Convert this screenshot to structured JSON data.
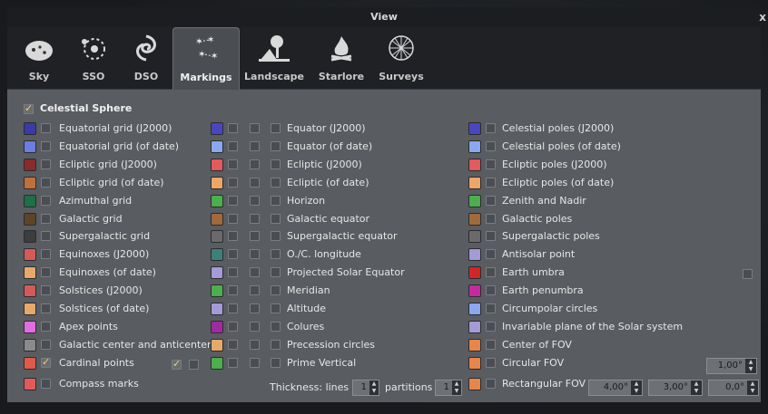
{
  "window": {
    "title": "View",
    "close_label": "x"
  },
  "tabs": [
    {
      "label": "Sky",
      "icon": "sky-icon"
    },
    {
      "label": "SSO",
      "icon": "sso-icon"
    },
    {
      "label": "DSO",
      "icon": "dso-icon"
    },
    {
      "label": "Markings",
      "icon": "markings-icon",
      "active": true
    },
    {
      "label": "Landscape",
      "icon": "landscape-icon"
    },
    {
      "label": "Starlore",
      "icon": "starlore-icon"
    },
    {
      "label": "Surveys",
      "icon": "surveys-icon"
    }
  ],
  "section": {
    "title": "Celestial Sphere",
    "checked": true
  },
  "col1": [
    {
      "label": "Equatorial grid (J2000)",
      "color": "#3b3aa6"
    },
    {
      "label": "Equatorial grid (of date)",
      "color": "#6a7fe0"
    },
    {
      "label": "Ecliptic grid (J2000)",
      "color": "#8a2b2b"
    },
    {
      "label": "Ecliptic grid (of date)",
      "color": "#c0703a"
    },
    {
      "label": "Azimuthal grid",
      "color": "#1f6e45"
    },
    {
      "label": "Galactic grid",
      "color": "#5c4428"
    },
    {
      "label": "Supergalactic grid",
      "color": "#3d3d3d"
    },
    {
      "label": "Equinoxes (J2000)",
      "color": "#d45a5a"
    },
    {
      "label": "Equinoxes (of date)",
      "color": "#e7a96a"
    },
    {
      "label": "Solstices (J2000)",
      "color": "#d45a5a"
    },
    {
      "label": "Solstices (of date)",
      "color": "#e7a96a"
    },
    {
      "label": "Apex points",
      "color": "#e06ee0"
    },
    {
      "label": "Galactic center and anticenter",
      "color": "#8a8a8a"
    },
    {
      "label": "Cardinal points",
      "color": "#e05a4a",
      "checked": true
    },
    {
      "label": "Compass marks",
      "color": "#e05a5a"
    }
  ],
  "col2": [
    {
      "label": "Equator (J2000)",
      "color": "#4a46c0"
    },
    {
      "label": "Equator (of date)",
      "color": "#8aa8f0"
    },
    {
      "label": "Ecliptic (J2000)",
      "color": "#e25a5a"
    },
    {
      "label": "Ecliptic (of date)",
      "color": "#eea666"
    },
    {
      "label": "Horizon",
      "color": "#4cae4c"
    },
    {
      "label": "Galactic equator",
      "color": "#a06a3a"
    },
    {
      "label": "Supergalactic equator",
      "color": "#6a6a6a"
    },
    {
      "label": "O./C. longitude",
      "color": "#3f7f7a"
    },
    {
      "label": "Projected Solar Equator",
      "color": "#a49ad6"
    },
    {
      "label": "Meridian",
      "color": "#4cae4c"
    },
    {
      "label": "Altitude",
      "color": "#a49ad6"
    },
    {
      "label": "Colures",
      "color": "#a02aa0"
    },
    {
      "label": "Precession circles",
      "color": "#e7a96a"
    },
    {
      "label": "Prime Vertical",
      "color": "#4cae4c"
    }
  ],
  "col3": [
    {
      "label": "Celestial poles (J2000)",
      "color": "#4a46c0"
    },
    {
      "label": "Celestial poles (of date)",
      "color": "#8aa8f0"
    },
    {
      "label": "Ecliptic poles (J2000)",
      "color": "#e25a5a"
    },
    {
      "label": "Ecliptic poles (of date)",
      "color": "#eea666"
    },
    {
      "label": "Zenith and Nadir",
      "color": "#4cae4c"
    },
    {
      "label": "Galactic poles",
      "color": "#a06a3a"
    },
    {
      "label": "Supergalactic poles",
      "color": "#6a6a6a"
    },
    {
      "label": "Antisolar point",
      "color": "#a49ad6"
    },
    {
      "label": "Earth umbra",
      "color": "#d42424"
    },
    {
      "label": "Earth penumbra",
      "color": "#c42aa0"
    },
    {
      "label": "Circumpolar circles",
      "color": "#8aa8f0"
    },
    {
      "label": "Invariable plane of the Solar system",
      "color": "#a49ad6"
    },
    {
      "label": "Center of FOV",
      "color": "#e8864a"
    },
    {
      "label": "Circular FOV",
      "color": "#e8864a"
    },
    {
      "label": "Rectangular FOV",
      "color": "#e8864a"
    }
  ],
  "thickness": {
    "label": "Thickness: lines",
    "lines_value": "1",
    "partitions_label": "partitions",
    "partitions_value": "1"
  },
  "fov": {
    "circular": "1,00°",
    "rect_w": "4,00°",
    "rect_h": "3,00°",
    "rect_rot": "0,0°"
  },
  "spinner_up": "▲",
  "spinner_down": "▼"
}
